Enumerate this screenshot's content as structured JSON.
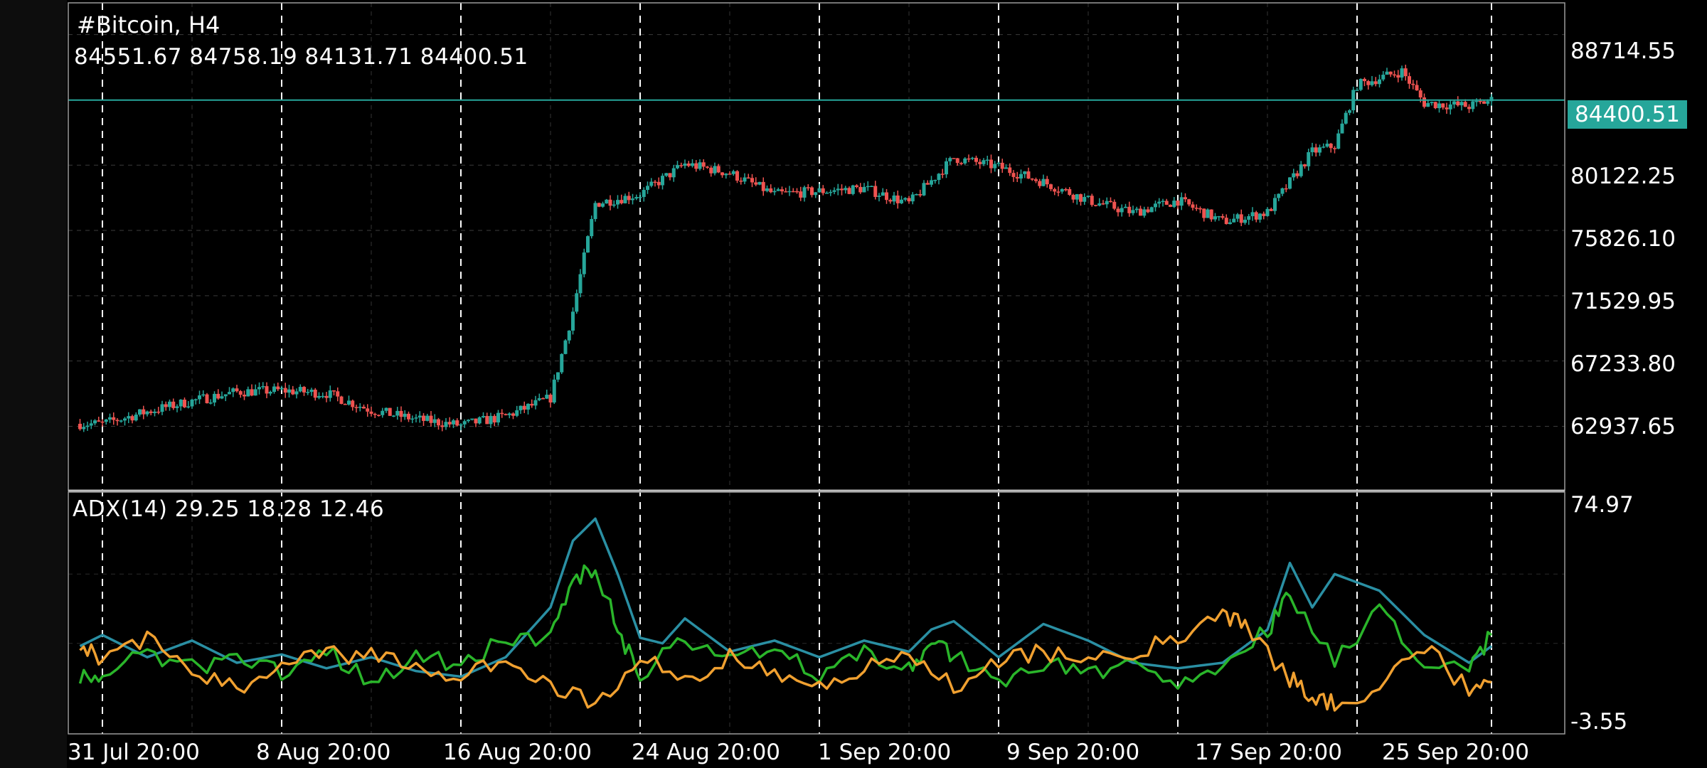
{
  "chart": {
    "symbol": "#Bitcoin, H4",
    "ohlc": "84551.67 84758.19 84131.71 84400.51",
    "current_price": "84400.51",
    "colors": {
      "background": "#000000",
      "up_candle": "#26a69a",
      "down_candle": "#ef5350",
      "grid": "#555555",
      "period_separator": "#ffffff",
      "current_price_line": "#26a69a",
      "adx_line": "#2a8fa3",
      "plus_di_line": "#2ab52a",
      "minus_di_line": "#f0a030"
    }
  },
  "price_axis": {
    "labels": [
      "88714.55",
      "80122.25",
      "75826.10",
      "71529.95",
      "67233.80",
      "62937.65"
    ]
  },
  "adx_axis": {
    "labels": [
      "74.97",
      "-3.55"
    ]
  },
  "indicator": {
    "legend": "ADX(14) 29.25 18.28 12.46"
  },
  "time_axis": {
    "labels": [
      "31 Jul 20:00",
      "8 Aug 20:00",
      "16 Aug 20:00",
      "24 Aug 20:00",
      "1 Sep 20:00",
      "9 Sep 20:00",
      "17 Sep 20:00",
      "25 Sep 20:00"
    ]
  },
  "chart_data": [
    {
      "type": "candlestick",
      "title": "#Bitcoin, H4",
      "ylim": [
        58700,
        90800
      ],
      "current_price": 84400.51,
      "x": [
        "31 Jul 20:00",
        "8 Aug 20:00",
        "16 Aug 20:00",
        "24 Aug 20:00",
        "1 Sep 20:00",
        "9 Sep 20:00",
        "17 Sep 20:00",
        "25 Sep 20:00"
      ],
      "close_path": [
        [
          "31 Jul 20:00",
          63100
        ],
        [
          "2 Aug 20:00",
          63900
        ],
        [
          "4 Aug 20:00",
          64600
        ],
        [
          "6 Aug 20:00",
          65200
        ],
        [
          "8 Aug 20:00",
          65300
        ],
        [
          "10 Aug 20:00",
          65100
        ],
        [
          "12 Aug 20:00",
          64000
        ],
        [
          "14 Aug 20:00",
          63400
        ],
        [
          "16 Aug 20:00",
          63000
        ],
        [
          "18 Aug 20:00",
          63600
        ],
        [
          "20 Aug 20:00",
          64800
        ],
        [
          "21 Aug 20:00",
          70500
        ],
        [
          "22 Aug 20:00",
          77600
        ],
        [
          "24 Aug 20:00",
          78200
        ],
        [
          "26 Aug 20:00",
          80200
        ],
        [
          "28 Aug 20:00",
          79600
        ],
        [
          "30 Aug 20:00",
          78200
        ],
        [
          "1 Sep 20:00",
          78400
        ],
        [
          "3 Sep 20:00",
          78600
        ],
        [
          "5 Sep 20:00",
          77600
        ],
        [
          "7 Sep 20:00",
          80600
        ],
        [
          "9 Sep 20:00",
          80000
        ],
        [
          "11 Sep 20:00",
          79000
        ],
        [
          "13 Sep 20:00",
          77800
        ],
        [
          "15 Sep 20:00",
          77000
        ],
        [
          "17 Sep 20:00",
          77800
        ],
        [
          "19 Sep 20:00",
          76400
        ],
        [
          "21 Sep 20:00",
          77000
        ],
        [
          "23 Sep 20:00",
          81000
        ],
        [
          "24 Sep 20:00",
          81400
        ],
        [
          "25 Sep 20:00",
          85400
        ],
        [
          "27 Sep 20:00",
          86300
        ],
        [
          "28 Sep 20:00",
          84200
        ],
        [
          "30 Sep 20:00",
          84000
        ],
        [
          "1 Oct 20:00",
          84400
        ]
      ]
    },
    {
      "type": "line",
      "title": "ADX(14) 29.25 18.28 12.46",
      "ylim": [
        -3.55,
        74.97
      ],
      "x": [
        "31 Jul 20:00",
        "8 Aug 20:00",
        "16 Aug 20:00",
        "24 Aug 20:00",
        "1 Sep 20:00",
        "9 Sep 20:00",
        "17 Sep 20:00",
        "25 Sep 20:00"
      ],
      "series": [
        {
          "values": [
            [
              "30 Jul 20:00",
              24
            ],
            [
              "31 Jul 20:00",
              28
            ],
            [
              "2 Aug 20:00",
              20
            ],
            [
              "4 Aug 20:00",
              26
            ],
            [
              "6 Aug 20:00",
              18
            ],
            [
              "8 Aug 20:00",
              21
            ],
            [
              "10 Aug 20:00",
              16
            ],
            [
              "12 Aug 20:00",
              20
            ],
            [
              "14 Aug 20:00",
              15
            ],
            [
              "16 Aug 20:00",
              13
            ],
            [
              "18 Aug 20:00",
              20
            ],
            [
              "20 Aug 20:00",
              38
            ],
            [
              "21 Aug 20:00",
              62
            ],
            [
              "22 Aug 20:00",
              70
            ],
            [
              "23 Aug 20:00",
              50
            ],
            [
              "24 Aug 20:00",
              27
            ],
            [
              "25 Aug 20:00",
              25
            ],
            [
              "26 Aug 20:00",
              34
            ],
            [
              "28 Aug 20:00",
              22
            ],
            [
              "30 Aug 20:00",
              26
            ],
            [
              "1 Sep 20:00",
              20
            ],
            [
              "3 Sep 20:00",
              26
            ],
            [
              "5 Sep 20:00",
              22
            ],
            [
              "6 Sep 20:00",
              30
            ],
            [
              "7 Sep 20:00",
              33
            ],
            [
              "9 Sep 20:00",
              20
            ],
            [
              "11 Sep 20:00",
              32
            ],
            [
              "13 Sep 20:00",
              26
            ],
            [
              "15 Sep 20:00",
              18
            ],
            [
              "17 Sep 20:00",
              16
            ],
            [
              "19 Sep 20:00",
              18
            ],
            [
              "21 Sep 20:00",
              30
            ],
            [
              "22 Sep 20:00",
              54
            ],
            [
              "23 Sep 20:00",
              38
            ],
            [
              "24 Sep 20:00",
              50
            ],
            [
              "26 Sep 20:00",
              44
            ],
            [
              "28 Sep 20:00",
              28
            ],
            [
              "30 Sep 20:00",
              18
            ],
            [
              "1 Oct 20:00",
              24
            ]
          ]
        },
        {
          "values": [
            [
              "30 Jul 20:00",
              14
            ],
            [
              "31 Jul 20:00",
              12
            ],
            [
              "2 Aug 20:00",
              22
            ],
            [
              "4 Aug 20:00",
              16
            ],
            [
              "6 Aug 20:00",
              20
            ],
            [
              "8 Aug 20:00",
              14
            ],
            [
              "10 Aug 20:00",
              22
            ],
            [
              "12 Aug 20:00",
              12
            ],
            [
              "14 Aug 20:00",
              20
            ],
            [
              "16 Aug 20:00",
              17
            ],
            [
              "18 Aug 20:00",
              26
            ],
            [
              "20 Aug 20:00",
              28
            ],
            [
              "21 Aug 20:00",
              48
            ],
            [
              "22 Aug 20:00",
              52
            ],
            [
              "23 Aug 20:00",
              30
            ],
            [
              "24 Aug 20:00",
              14
            ],
            [
              "26 Aug 20:00",
              26
            ],
            [
              "28 Aug 20:00",
              18
            ],
            [
              "30 Aug 20:00",
              24
            ],
            [
              "1 Sep 20:00",
              14
            ],
            [
              "3 Sep 20:00",
              22
            ],
            [
              "5 Sep 20:00",
              16
            ],
            [
              "6 Sep 20:00",
              26
            ],
            [
              "7 Sep 20:00",
              20
            ],
            [
              "9 Sep 20:00",
              12
            ],
            [
              "11 Sep 20:00",
              18
            ],
            [
              "13 Sep 20:00",
              14
            ],
            [
              "15 Sep 20:00",
              20
            ],
            [
              "17 Sep 20:00",
              12
            ],
            [
              "19 Sep 20:00",
              14
            ],
            [
              "21 Sep 20:00",
              30
            ],
            [
              "22 Sep 20:00",
              42
            ],
            [
              "24 Sep 20:00",
              20
            ],
            [
              "26 Sep 20:00",
              36
            ],
            [
              "28 Sep 20:00",
              18
            ],
            [
              "30 Sep 20:00",
              16
            ],
            [
              "1 Oct 20:00",
              28
            ]
          ]
        },
        {
          "values": [
            [
              "30 Jul 20:00",
              26
            ],
            [
              "31 Jul 20:00",
              18
            ],
            [
              "2 Aug 20:00",
              28
            ],
            [
              "4 Aug 20:00",
              14
            ],
            [
              "6 Aug 20:00",
              8
            ],
            [
              "8 Aug 20:00",
              20
            ],
            [
              "10 Aug 20:00",
              22
            ],
            [
              "12 Aug 20:00",
              20
            ],
            [
              "14 Aug 20:00",
              16
            ],
            [
              "16 Aug 20:00",
              12
            ],
            [
              "18 Aug 20:00",
              20
            ],
            [
              "20 Aug 20:00",
              10
            ],
            [
              "22 Aug 20:00",
              4
            ],
            [
              "24 Aug 20:00",
              20
            ],
            [
              "26 Aug 20:00",
              12
            ],
            [
              "28 Aug 20:00",
              20
            ],
            [
              "30 Aug 20:00",
              14
            ],
            [
              "1 Sep 20:00",
              10
            ],
            [
              "3 Sep 20:00",
              16
            ],
            [
              "5 Sep 20:00",
              20
            ],
            [
              "7 Sep 20:00",
              10
            ],
            [
              "9 Sep 20:00",
              18
            ],
            [
              "11 Sep 20:00",
              22
            ],
            [
              "13 Sep 20:00",
              18
            ],
            [
              "15 Sep 20:00",
              22
            ],
            [
              "17 Sep 20:00",
              26
            ],
            [
              "19 Sep 20:00",
              36
            ],
            [
              "20 Sep 20:00",
              32
            ],
            [
              "22 Sep 20:00",
              12
            ],
            [
              "23 Sep 20:00",
              6
            ],
            [
              "24 Sep 20:00",
              4
            ],
            [
              "26 Sep 20:00",
              8
            ],
            [
              "28 Sep 20:00",
              24
            ],
            [
              "30 Sep 20:00",
              8
            ],
            [
              "1 Oct 20:00",
              11
            ]
          ]
        }
      ]
    }
  ]
}
